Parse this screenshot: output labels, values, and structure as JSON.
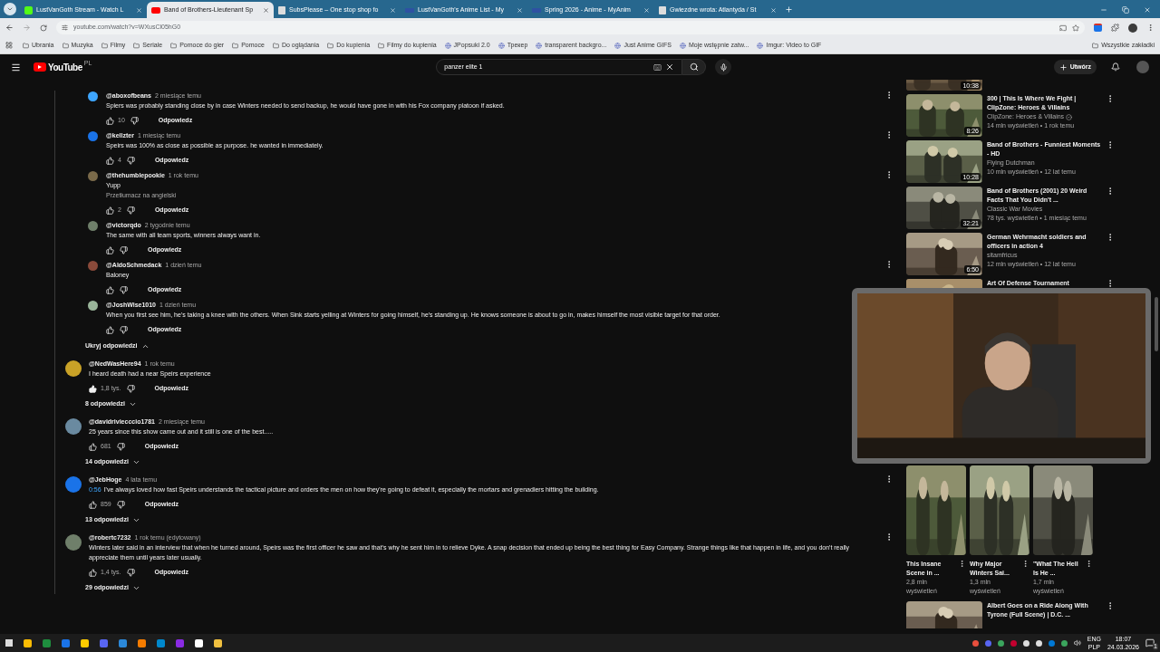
{
  "tabs": [
    {
      "title": "LustVanGoth Stream - Watch L",
      "selected": false
    },
    {
      "title": "Band of Brothers-Lieutenant Sp",
      "selected": true
    },
    {
      "title": "SubsPlease – One stop shop fo",
      "selected": false
    },
    {
      "title": "LustVanGoth's Anime List - My",
      "selected": false
    },
    {
      "title": "Spring 2026 - Anime - MyAnim",
      "selected": false
    },
    {
      "title": "Gwiezdne wrota: Atlantyda / St",
      "selected": false
    }
  ],
  "address": "youtube.com/watch?v=WXusCl05hG0",
  "bookmarks": [
    {
      "label": "Ubrania",
      "kind": "folder"
    },
    {
      "label": "Muzyka",
      "kind": "folder"
    },
    {
      "label": "Filmy",
      "kind": "folder"
    },
    {
      "label": "Seriale",
      "kind": "folder"
    },
    {
      "label": "Pomoce do gier",
      "kind": "folder"
    },
    {
      "label": "Pomoce",
      "kind": "folder"
    },
    {
      "label": "Do oglądania",
      "kind": "folder"
    },
    {
      "label": "Do kupienia",
      "kind": "folder"
    },
    {
      "label": "Filmy do kupienia",
      "kind": "folder"
    },
    {
      "label": "JPopsuki 2.0",
      "kind": "site"
    },
    {
      "label": "Трекер",
      "kind": "site"
    },
    {
      "label": "transparent backgro...",
      "kind": "site"
    },
    {
      "label": "Just Anime GIFS",
      "kind": "site"
    },
    {
      "label": "Moje wstępnie zatw...",
      "kind": "site"
    },
    {
      "label": "Imgur: Video to GIF",
      "kind": "site"
    }
  ],
  "all_bookmarks": "Wszystkie zakładki",
  "youtube": {
    "logo": "YouTube",
    "region": "PL",
    "search": "panzer elite 1",
    "create": "Utwórz"
  },
  "comments": [
    {
      "kind": "reply",
      "author": "@aboxofbeans",
      "time": "2 miesiące temu",
      "text": "Spiers was probably standing close by in case Winters needed to send backup, he would have gone in with his Fox company platoon if asked.",
      "likes": "10",
      "liked": false,
      "reply": "Odpowiedz",
      "menu": true
    },
    {
      "kind": "reply",
      "author": "@kellzter",
      "time": "1 miesiąc temu",
      "text": "Speirs was 100% as close as possible as purpose. he wanted in immediately.",
      "likes": "4",
      "liked": false,
      "reply": "Odpowiedz",
      "menu": true
    },
    {
      "kind": "reply",
      "author": "@thehumblepookie",
      "time": "1 rok temu",
      "text": "Yupp",
      "translate": "Przetłumacz na angielski",
      "likes": "2",
      "liked": false,
      "reply": "Odpowiedz",
      "menu": true
    },
    {
      "kind": "reply",
      "author": "@victorqdo",
      "time": "2 tygodnie temu",
      "text": "The same with all team sports, winners always want in.",
      "liked": false,
      "reply": "Odpowiedz",
      "menu": false
    },
    {
      "kind": "reply",
      "author": "@AldoSchmedack",
      "time": "1 dzień temu",
      "text": "Baloney",
      "liked": false,
      "reply": "Odpowiedz",
      "menu": true
    },
    {
      "kind": "reply",
      "author": "@JoshWise1010",
      "time": "1 dzień temu",
      "text": "When you first see him, he's taking a knee with the others. When Sink starts yelling at Winters for going himself, he's standing up. He knows someone is about to go in, makes himself the most visible target for that order.",
      "liked": false,
      "reply": "Odpowiedz"
    },
    {
      "kind": "toggle",
      "label": "Ukryj odpowiedzi",
      "expanded": true
    },
    {
      "kind": "comment",
      "author": "@NedWasHere94",
      "time": "1 rok temu",
      "text": "I heard death had a near Speirs experience",
      "likes": "1,8 tys.",
      "liked": true,
      "reply": "Odpowiedz"
    },
    {
      "kind": "toggle",
      "label": "8 odpowiedzi",
      "expanded": false
    },
    {
      "kind": "comment",
      "author": "@davidriviecccio1781",
      "time": "2 miesiące temu",
      "text": "25 years since this show came out and it still is one of the best.....",
      "likes": "681",
      "liked": false,
      "reply": "Odpowiedz"
    },
    {
      "kind": "toggle",
      "label": "14 odpowiedzi",
      "expanded": false
    },
    {
      "kind": "comment",
      "author": "@JebHoge",
      "time": "4 lata temu",
      "timestamp": "0:56",
      "text": "I've always loved how fast Speirs understands the tactical picture and orders the men on how they're going to defeat it, especially the mortars and grenadiers hitting the building.",
      "likes": "859",
      "liked": false,
      "reply": "Odpowiedz",
      "menu": true
    },
    {
      "kind": "toggle",
      "label": "13 odpowiedzi",
      "expanded": false
    },
    {
      "kind": "comment",
      "author": "@robertc7232",
      "time": "1 rok temu (edytowany)",
      "text": "Winters later said in an interview that when he turned around, Speirs was the first officer he saw and that's why he sent him in to relieve Dyke.  A snap decision that ended up being the best thing for Easy Company.  Strange things like that happen in life, and you don't really appreciate them until years later usually.",
      "likes": "1,4 tys.",
      "liked": false,
      "reply": "Odpowiedz",
      "menu": true
    },
    {
      "kind": "toggle",
      "label": "29 odpowiedzi",
      "expanded": false
    }
  ],
  "sidebar": [
    {
      "kind": "partial",
      "duration": "10:38"
    },
    {
      "kind": "video",
      "title": "300 | This Is Where We Fight | ClipZone: Heroes & Villains",
      "channel": "ClipZone: Heroes & Villains",
      "verified": true,
      "meta": "14 mln wyświetleń • 1 rok temu",
      "duration": "8:26"
    },
    {
      "kind": "video",
      "title": "Band of Brothers - Funniest Moments - HD",
      "channel": "Flying Dutchman",
      "verified": false,
      "meta": "10 mln wyświetleń • 12 lat temu",
      "duration": "10:28"
    },
    {
      "kind": "video",
      "title": "Band of Brothers (2001) 20 Weird Facts That You Didn't ...",
      "channel": "Classic War Movies",
      "verified": false,
      "meta": "78 tys. wyświetleń • 1 miesiąc temu",
      "duration": "32:21"
    },
    {
      "kind": "video",
      "title": "German Wehrmacht soldiers and officers in action 4",
      "channel": "sitamfricus",
      "verified": false,
      "meta": "12 mln wyświetleń • 12 lat temu",
      "duration": "6:50"
    },
    {
      "kind": "cut",
      "title": "Art Of Defense Tournament"
    }
  ],
  "shorts": [
    {
      "title": "This Insane Scene in ...",
      "views": "2,8 mln",
      "unit": "wyświetleń"
    },
    {
      "title": "Why Major Winters Sai...",
      "views": "1,3 mln",
      "unit": "wyświetleń"
    },
    {
      "title": "\"What The Hell Is He ...",
      "views": "1,7 mln",
      "unit": "wyświetleń"
    }
  ],
  "next_video": {
    "title": "Albert Goes on a Ride Along With Tyrone (Full Scene) | D.C. ..."
  },
  "taskbar": {
    "lang": "ENG",
    "layout": "PLP",
    "time": "18:07",
    "date": "24.03.2026",
    "notifications": "1"
  }
}
